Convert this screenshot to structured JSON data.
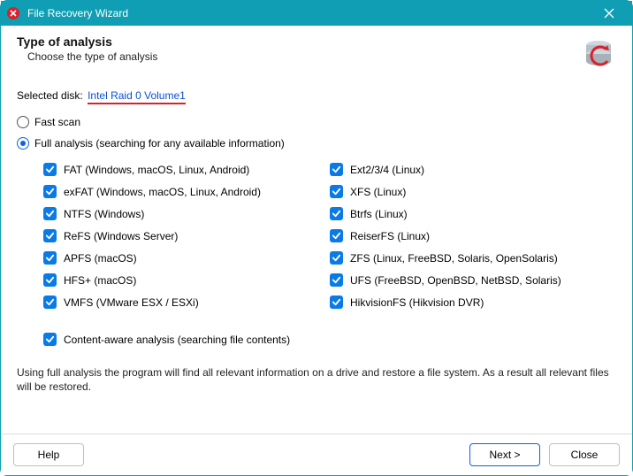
{
  "window": {
    "title": "File Recovery Wizard"
  },
  "header": {
    "title": "Type of analysis",
    "subtitle": "Choose the type of analysis"
  },
  "selected_disk": {
    "label": "Selected disk:",
    "value": "Intel Raid 0 Volume1"
  },
  "options": {
    "fast_scan": {
      "label": "Fast scan",
      "selected": false
    },
    "full_analysis": {
      "label": "Full analysis (searching for any available information)",
      "selected": true
    }
  },
  "filesystems": {
    "left": [
      {
        "label": "FAT (Windows, macOS, Linux, Android)",
        "checked": true
      },
      {
        "label": "exFAT (Windows, macOS, Linux, Android)",
        "checked": true
      },
      {
        "label": "NTFS (Windows)",
        "checked": true
      },
      {
        "label": "ReFS (Windows Server)",
        "checked": true
      },
      {
        "label": "APFS (macOS)",
        "checked": true
      },
      {
        "label": "HFS+ (macOS)",
        "checked": true
      },
      {
        "label": "VMFS (VMware ESX / ESXi)",
        "checked": true
      }
    ],
    "right": [
      {
        "label": "Ext2/3/4 (Linux)",
        "checked": true
      },
      {
        "label": "XFS (Linux)",
        "checked": true
      },
      {
        "label": "Btrfs (Linux)",
        "checked": true
      },
      {
        "label": "ReiserFS (Linux)",
        "checked": true
      },
      {
        "label": "ZFS (Linux, FreeBSD, Solaris, OpenSolaris)",
        "checked": true
      },
      {
        "label": "UFS (FreeBSD, OpenBSD, NetBSD, Solaris)",
        "checked": true
      },
      {
        "label": "HikvisionFS (Hikvision DVR)",
        "checked": true
      }
    ]
  },
  "content_aware": {
    "label": "Content-aware analysis (searching file contents)",
    "checked": true
  },
  "description": "Using full analysis the program will find all relevant information on a drive and restore a file system. As a result all relevant files will be restored.",
  "buttons": {
    "help": "Help",
    "next": "Next >",
    "close": "Close"
  }
}
